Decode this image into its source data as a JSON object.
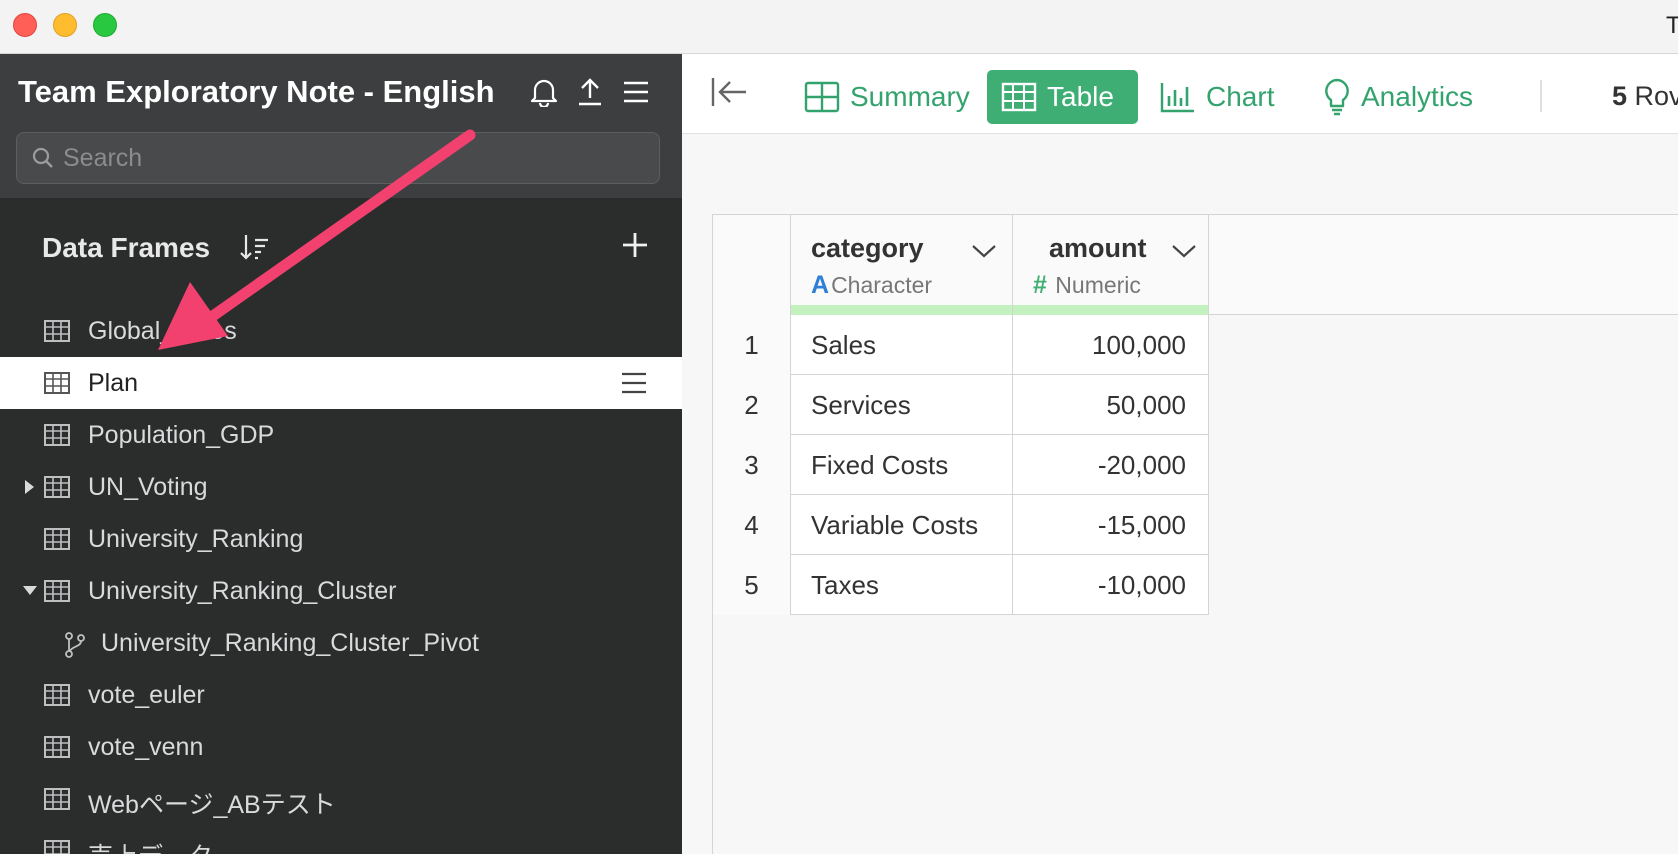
{
  "window": {
    "title_fragment": "T"
  },
  "sidebar": {
    "title": "Team Exploratory Note - English",
    "search_placeholder": "Search",
    "section_title": "Data Frames",
    "items": [
      {
        "label": "Global_Sales"
      },
      {
        "label": "Plan"
      },
      {
        "label": "Population_GDP"
      },
      {
        "label": "UN_Voting"
      },
      {
        "label": "University_Ranking"
      },
      {
        "label": "University_Ranking_Cluster"
      },
      {
        "label": "University_Ranking_Cluster_Pivot"
      },
      {
        "label": "vote_euler"
      },
      {
        "label": "vote_venn"
      },
      {
        "label": "Webページ_ABテスト"
      },
      {
        "label": "売上データ"
      }
    ]
  },
  "toolbar": {
    "tabs": [
      {
        "label": "Summary"
      },
      {
        "label": "Table"
      },
      {
        "label": "Chart"
      },
      {
        "label": "Analytics"
      }
    ],
    "rows_count": "5",
    "rows_suffix": "Rov"
  },
  "table": {
    "columns": [
      {
        "name": "category",
        "type_glyph": "A",
        "type": "Character"
      },
      {
        "name": "amount",
        "type_glyph": "#",
        "type": "Numeric"
      }
    ],
    "rows": [
      {
        "n": "1",
        "category": "Sales",
        "amount": "100,000"
      },
      {
        "n": "2",
        "category": "Services",
        "amount": "50,000"
      },
      {
        "n": "3",
        "category": "Fixed Costs",
        "amount": "-20,000"
      },
      {
        "n": "4",
        "category": "Variable Costs",
        "amount": "-15,000"
      },
      {
        "n": "5",
        "category": "Taxes",
        "amount": "-10,000"
      }
    ]
  },
  "colors": {
    "accent_green": "#3fae75",
    "annotation_arrow": "#f2416f",
    "character_type": "#2f7fd6",
    "numeric_type": "#3fae75"
  }
}
